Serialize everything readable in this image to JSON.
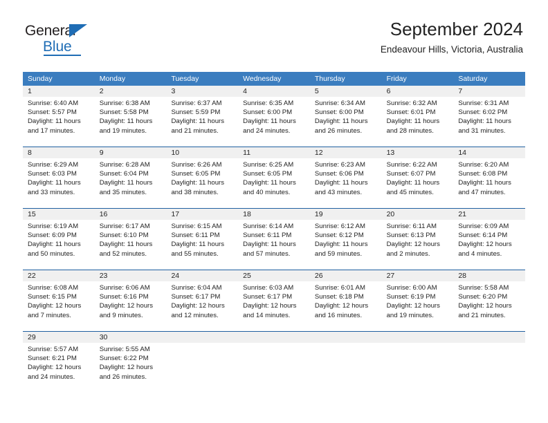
{
  "logo": {
    "word_top": "General",
    "word_bottom": "Blue",
    "accent_color": "#1f6db5"
  },
  "header": {
    "title": "September 2024",
    "subtitle": "Endeavour Hills, Victoria, Australia"
  },
  "theme": {
    "header_row_color": "#3b7dbf",
    "row_divider_color": "#1f5fa0",
    "day_band_color": "#f0f0f0",
    "text_color": "#222222"
  },
  "weekdays": [
    "Sunday",
    "Monday",
    "Tuesday",
    "Wednesday",
    "Thursday",
    "Friday",
    "Saturday"
  ],
  "weeks": [
    [
      {
        "day": "1",
        "sunrise": "Sunrise: 6:40 AM",
        "sunset": "Sunset: 5:57 PM",
        "daylight_line1": "Daylight: 11 hours",
        "daylight_line2": "and 17 minutes."
      },
      {
        "day": "2",
        "sunrise": "Sunrise: 6:38 AM",
        "sunset": "Sunset: 5:58 PM",
        "daylight_line1": "Daylight: 11 hours",
        "daylight_line2": "and 19 minutes."
      },
      {
        "day": "3",
        "sunrise": "Sunrise: 6:37 AM",
        "sunset": "Sunset: 5:59 PM",
        "daylight_line1": "Daylight: 11 hours",
        "daylight_line2": "and 21 minutes."
      },
      {
        "day": "4",
        "sunrise": "Sunrise: 6:35 AM",
        "sunset": "Sunset: 6:00 PM",
        "daylight_line1": "Daylight: 11 hours",
        "daylight_line2": "and 24 minutes."
      },
      {
        "day": "5",
        "sunrise": "Sunrise: 6:34 AM",
        "sunset": "Sunset: 6:00 PM",
        "daylight_line1": "Daylight: 11 hours",
        "daylight_line2": "and 26 minutes."
      },
      {
        "day": "6",
        "sunrise": "Sunrise: 6:32 AM",
        "sunset": "Sunset: 6:01 PM",
        "daylight_line1": "Daylight: 11 hours",
        "daylight_line2": "and 28 minutes."
      },
      {
        "day": "7",
        "sunrise": "Sunrise: 6:31 AM",
        "sunset": "Sunset: 6:02 PM",
        "daylight_line1": "Daylight: 11 hours",
        "daylight_line2": "and 31 minutes."
      }
    ],
    [
      {
        "day": "8",
        "sunrise": "Sunrise: 6:29 AM",
        "sunset": "Sunset: 6:03 PM",
        "daylight_line1": "Daylight: 11 hours",
        "daylight_line2": "and 33 minutes."
      },
      {
        "day": "9",
        "sunrise": "Sunrise: 6:28 AM",
        "sunset": "Sunset: 6:04 PM",
        "daylight_line1": "Daylight: 11 hours",
        "daylight_line2": "and 35 minutes."
      },
      {
        "day": "10",
        "sunrise": "Sunrise: 6:26 AM",
        "sunset": "Sunset: 6:05 PM",
        "daylight_line1": "Daylight: 11 hours",
        "daylight_line2": "and 38 minutes."
      },
      {
        "day": "11",
        "sunrise": "Sunrise: 6:25 AM",
        "sunset": "Sunset: 6:05 PM",
        "daylight_line1": "Daylight: 11 hours",
        "daylight_line2": "and 40 minutes."
      },
      {
        "day": "12",
        "sunrise": "Sunrise: 6:23 AM",
        "sunset": "Sunset: 6:06 PM",
        "daylight_line1": "Daylight: 11 hours",
        "daylight_line2": "and 43 minutes."
      },
      {
        "day": "13",
        "sunrise": "Sunrise: 6:22 AM",
        "sunset": "Sunset: 6:07 PM",
        "daylight_line1": "Daylight: 11 hours",
        "daylight_line2": "and 45 minutes."
      },
      {
        "day": "14",
        "sunrise": "Sunrise: 6:20 AM",
        "sunset": "Sunset: 6:08 PM",
        "daylight_line1": "Daylight: 11 hours",
        "daylight_line2": "and 47 minutes."
      }
    ],
    [
      {
        "day": "15",
        "sunrise": "Sunrise: 6:19 AM",
        "sunset": "Sunset: 6:09 PM",
        "daylight_line1": "Daylight: 11 hours",
        "daylight_line2": "and 50 minutes."
      },
      {
        "day": "16",
        "sunrise": "Sunrise: 6:17 AM",
        "sunset": "Sunset: 6:10 PM",
        "daylight_line1": "Daylight: 11 hours",
        "daylight_line2": "and 52 minutes."
      },
      {
        "day": "17",
        "sunrise": "Sunrise: 6:15 AM",
        "sunset": "Sunset: 6:11 PM",
        "daylight_line1": "Daylight: 11 hours",
        "daylight_line2": "and 55 minutes."
      },
      {
        "day": "18",
        "sunrise": "Sunrise: 6:14 AM",
        "sunset": "Sunset: 6:11 PM",
        "daylight_line1": "Daylight: 11 hours",
        "daylight_line2": "and 57 minutes."
      },
      {
        "day": "19",
        "sunrise": "Sunrise: 6:12 AM",
        "sunset": "Sunset: 6:12 PM",
        "daylight_line1": "Daylight: 11 hours",
        "daylight_line2": "and 59 minutes."
      },
      {
        "day": "20",
        "sunrise": "Sunrise: 6:11 AM",
        "sunset": "Sunset: 6:13 PM",
        "daylight_line1": "Daylight: 12 hours",
        "daylight_line2": "and 2 minutes."
      },
      {
        "day": "21",
        "sunrise": "Sunrise: 6:09 AM",
        "sunset": "Sunset: 6:14 PM",
        "daylight_line1": "Daylight: 12 hours",
        "daylight_line2": "and 4 minutes."
      }
    ],
    [
      {
        "day": "22",
        "sunrise": "Sunrise: 6:08 AM",
        "sunset": "Sunset: 6:15 PM",
        "daylight_line1": "Daylight: 12 hours",
        "daylight_line2": "and 7 minutes."
      },
      {
        "day": "23",
        "sunrise": "Sunrise: 6:06 AM",
        "sunset": "Sunset: 6:16 PM",
        "daylight_line1": "Daylight: 12 hours",
        "daylight_line2": "and 9 minutes."
      },
      {
        "day": "24",
        "sunrise": "Sunrise: 6:04 AM",
        "sunset": "Sunset: 6:17 PM",
        "daylight_line1": "Daylight: 12 hours",
        "daylight_line2": "and 12 minutes."
      },
      {
        "day": "25",
        "sunrise": "Sunrise: 6:03 AM",
        "sunset": "Sunset: 6:17 PM",
        "daylight_line1": "Daylight: 12 hours",
        "daylight_line2": "and 14 minutes."
      },
      {
        "day": "26",
        "sunrise": "Sunrise: 6:01 AM",
        "sunset": "Sunset: 6:18 PM",
        "daylight_line1": "Daylight: 12 hours",
        "daylight_line2": "and 16 minutes."
      },
      {
        "day": "27",
        "sunrise": "Sunrise: 6:00 AM",
        "sunset": "Sunset: 6:19 PM",
        "daylight_line1": "Daylight: 12 hours",
        "daylight_line2": "and 19 minutes."
      },
      {
        "day": "28",
        "sunrise": "Sunrise: 5:58 AM",
        "sunset": "Sunset: 6:20 PM",
        "daylight_line1": "Daylight: 12 hours",
        "daylight_line2": "and 21 minutes."
      }
    ],
    [
      {
        "day": "29",
        "sunrise": "Sunrise: 5:57 AM",
        "sunset": "Sunset: 6:21 PM",
        "daylight_line1": "Daylight: 12 hours",
        "daylight_line2": "and 24 minutes."
      },
      {
        "day": "30",
        "sunrise": "Sunrise: 5:55 AM",
        "sunset": "Sunset: 6:22 PM",
        "daylight_line1": "Daylight: 12 hours",
        "daylight_line2": "and 26 minutes."
      },
      {
        "day": "",
        "sunrise": "",
        "sunset": "",
        "daylight_line1": "",
        "daylight_line2": ""
      },
      {
        "day": "",
        "sunrise": "",
        "sunset": "",
        "daylight_line1": "",
        "daylight_line2": ""
      },
      {
        "day": "",
        "sunrise": "",
        "sunset": "",
        "daylight_line1": "",
        "daylight_line2": ""
      },
      {
        "day": "",
        "sunrise": "",
        "sunset": "",
        "daylight_line1": "",
        "daylight_line2": ""
      },
      {
        "day": "",
        "sunrise": "",
        "sunset": "",
        "daylight_line1": "",
        "daylight_line2": ""
      }
    ]
  ]
}
